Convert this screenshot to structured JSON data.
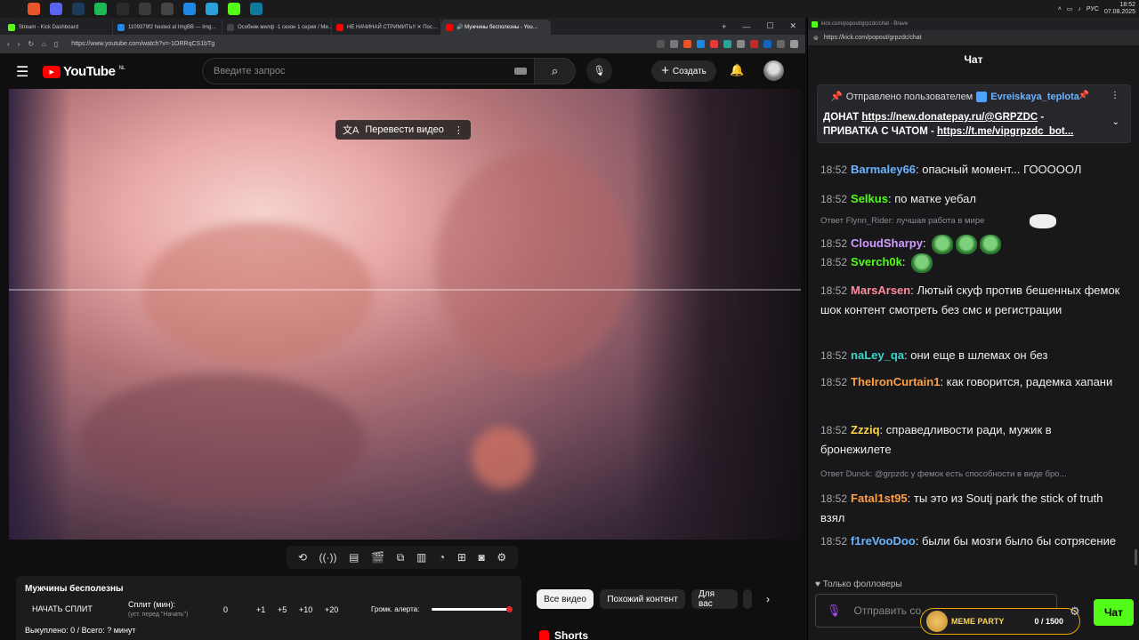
{
  "taskbar": {
    "icons": [
      {
        "name": "windows-start-icon",
        "glyph": "",
        "color": "#1b1b1b"
      },
      {
        "name": "brave-icon",
        "glyph": "",
        "color": "#e8552b"
      },
      {
        "name": "discord-icon",
        "glyph": "",
        "color": "#5865f2"
      },
      {
        "name": "steam-icon",
        "glyph": "",
        "color": "#1b3a5c"
      },
      {
        "name": "spotify-icon",
        "glyph": "",
        "color": "#1db954"
      },
      {
        "name": "obs-icon",
        "glyph": "",
        "color": "#2b2b2b"
      },
      {
        "name": "app-icon",
        "glyph": "",
        "color": "#3a3a3a"
      },
      {
        "name": "xbox-icon",
        "glyph": "",
        "color": "#444"
      },
      {
        "name": "skype-icon",
        "glyph": "",
        "color": "#1e88e5"
      },
      {
        "name": "telegram-icon",
        "glyph": "",
        "color": "#2aa1da"
      },
      {
        "name": "kick-app-icon",
        "glyph": "",
        "color": "#53fc18"
      },
      {
        "name": "edge-icon",
        "glyph": "",
        "color": "#0f7b9e"
      }
    ],
    "lang": "РУС",
    "time": "18:52",
    "date": "07.08.2025"
  },
  "browser": {
    "tabs": [
      {
        "label": "Stream - Kick Dashboard",
        "fav": "#53fc18",
        "active": false
      },
      {
        "label": "1109379f2 hosted at ImgBB — Img…",
        "fav": "#1e88e5",
        "active": false
      },
      {
        "label": "Особняк милф -1 сезон 1 серия / Ми…",
        "fav": "#444",
        "active": false
      },
      {
        "label": "НЕ НАЧИНАЙ СТРИМИТЬ!! ✕ Пос…",
        "fav": "#ff0000",
        "active": false
      },
      {
        "label": "🔊 Мужчины бесполезны - You…",
        "fav": "#ff0000",
        "active": true
      }
    ],
    "url": "https://www.youtube.com/watch?v=-1ORRqCS1bTg"
  },
  "youtube": {
    "logo_text": "YouTube",
    "region": "NL",
    "search_placeholder": "Введите запрос",
    "create_label": "Создать",
    "translate_label": "Перевести видео"
  },
  "split": {
    "title": "Мужчины бесполезны",
    "start_label": "НАЧАТЬ СПЛИТ",
    "split_min_label": "Сплит (мин):",
    "split_min_hint": "(уст. перед \"Начать\")",
    "value": "0",
    "buttons": [
      "+1",
      "+5",
      "+10",
      "+20"
    ],
    "volume_label": "Громк. алерта:",
    "volume_fraction": 1.0,
    "bought": "Выкуплено: 0 / Всего: ? минут"
  },
  "chips": [
    "Все видео",
    "Похожий контент",
    "Для вас"
  ],
  "shorts_label": "Shorts",
  "kick": {
    "window_title": "kick.com/popout/grpzdc/chat - Brave",
    "url": "https://kick.com/popout/grpzdc/chat",
    "header": "Чат",
    "pinned": {
      "sent_by": "Отправлено пользователем",
      "user": "Evreiskaya_teplota",
      "line1_prefix": "ДОНАТ ",
      "line1_link": "https://new.donatepay.ru/@GRPZDC",
      "line1_suffix": " -",
      "line2_prefix": "ПРИВАТКА С ЧАТОМ - ",
      "line2_link": "https://t.me/vipgrpzdc_bot..."
    },
    "messages": [
      {
        "time": "18:52",
        "user": "Barmaley66",
        "color": "#6bb5ff",
        "text": "опасный момент... ГОООООЛ"
      },
      {
        "time": "18:52",
        "user": "Selkus",
        "color": "#53fc18",
        "text": "по матке уебал"
      },
      {
        "time": "18:52",
        "user": "CloudSharpy",
        "color": "#d29bff",
        "text": "",
        "reply": "Ответ Flynn_Rider: лучшая работа в мире"
      },
      {
        "time": "18:52",
        "user": "Sverch0k",
        "color": "#53fc18",
        "text": ""
      },
      {
        "time": "18:52",
        "user": "MarsArsen",
        "color": "#ff8a9c",
        "text": "Лютый скуф против бешенных фемок шок контент смотреть без смс и регистрации"
      },
      {
        "time": "18:52",
        "user": "naLey_qa",
        "color": "#3ad4c9",
        "text": "они еще в шлемах он без"
      },
      {
        "time": "18:52",
        "user": "TheIronCurtain1",
        "color": "#ff9f43",
        "text": "как говорится, радемка хапани"
      },
      {
        "time": "18:52",
        "user": "Zzziq",
        "color": "#ffd54a",
        "text": "справедливости ради, мужик в бронежилете"
      },
      {
        "time": "18:52",
        "user": "Fatal1st95",
        "color": "#ff9f43",
        "text": "ты это из Soutj park the stick of truth взял",
        "reply": "Ответ Dunck: @grpzdc у фемок есть способности в виде бро..."
      },
      {
        "time": "18:52",
        "user": "f1reVooDoo",
        "color": "#6bb5ff",
        "text": "были бы мозги было бы сотрясение"
      }
    ],
    "followers_only": "Только фолловеры",
    "input_placeholder": "Отправить со...",
    "meme_party": "MEME PARTY",
    "meme_count": "0 / 1500",
    "send_label": "Чат"
  }
}
